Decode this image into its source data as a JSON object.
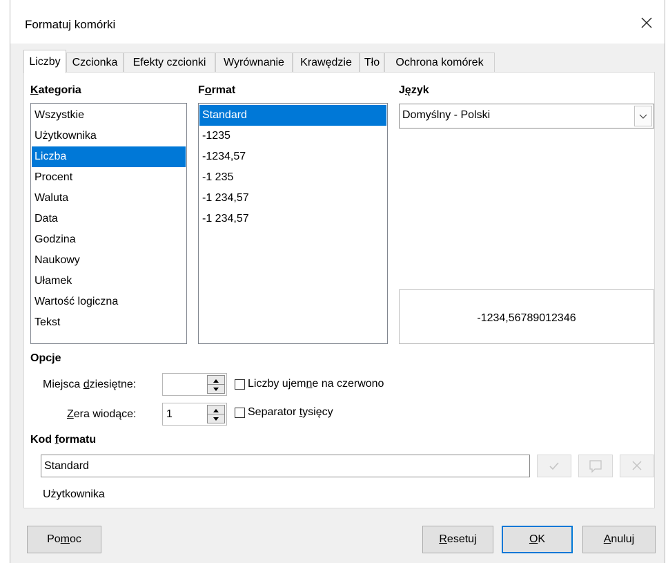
{
  "window": {
    "title": "Formatuj komórki"
  },
  "tabs": [
    {
      "label": "Liczby",
      "active": true
    },
    {
      "label": "Czcionka",
      "active": false
    },
    {
      "label": "Efekty czcionki",
      "active": false
    },
    {
      "label": "Wyrównanie",
      "active": false
    },
    {
      "label": "Krawędzie",
      "active": false
    },
    {
      "label": "Tło",
      "active": false
    },
    {
      "label": "Ochrona komórek",
      "active": false
    }
  ],
  "category": {
    "header_pre": "",
    "header_ul": "K",
    "header_post": "ategoria",
    "items": [
      "Wszystkie",
      "Użytkownika",
      "Liczba",
      "Procent",
      "Waluta",
      "Data",
      "Godzina",
      "Naukowy",
      "Ułamek",
      "Wartość logiczna",
      "Tekst"
    ],
    "selected_index": 2
  },
  "format": {
    "header_pre": "F",
    "header_ul": "o",
    "header_post": "rmat",
    "items": [
      "Standard",
      "-1235",
      "-1234,57",
      "-1 235",
      "-1 234,57",
      "-1 234,57"
    ],
    "selected_index": 0
  },
  "language": {
    "header_pre": "J",
    "header_ul": "ę",
    "header_post": "zyk",
    "value": "Domyślny - Polski"
  },
  "preview": {
    "text": "-1234,56789012346"
  },
  "options": {
    "header": "Opcje",
    "decimal_label_pre": "Miejsca ",
    "decimal_label_ul": "d",
    "decimal_label_post": "ziesiętne:",
    "decimal_value": "",
    "leading_label_pre": "",
    "leading_label_ul": "Z",
    "leading_label_post": "era wiodące:",
    "leading_value": "1",
    "negative_red_pre": "Liczby ujem",
    "negative_red_ul": "n",
    "negative_red_post": "e na czerwono",
    "negative_red_checked": false,
    "thousands_pre": "Separator ",
    "thousands_ul": "t",
    "thousands_post": "ysięcy",
    "thousands_checked": false
  },
  "format_code": {
    "header_pre": "Kod ",
    "header_ul": "f",
    "header_post": "ormatu",
    "value": "Standard",
    "description": "Użytkownika"
  },
  "buttons": {
    "help_pre": "Po",
    "help_ul": "m",
    "help_post": "oc",
    "reset_pre": "",
    "reset_ul": "R",
    "reset_post": "esetuj",
    "ok_pre": "",
    "ok_ul": "O",
    "ok_post": "K",
    "cancel_pre": "",
    "cancel_ul": "A",
    "cancel_post": "nuluj"
  }
}
